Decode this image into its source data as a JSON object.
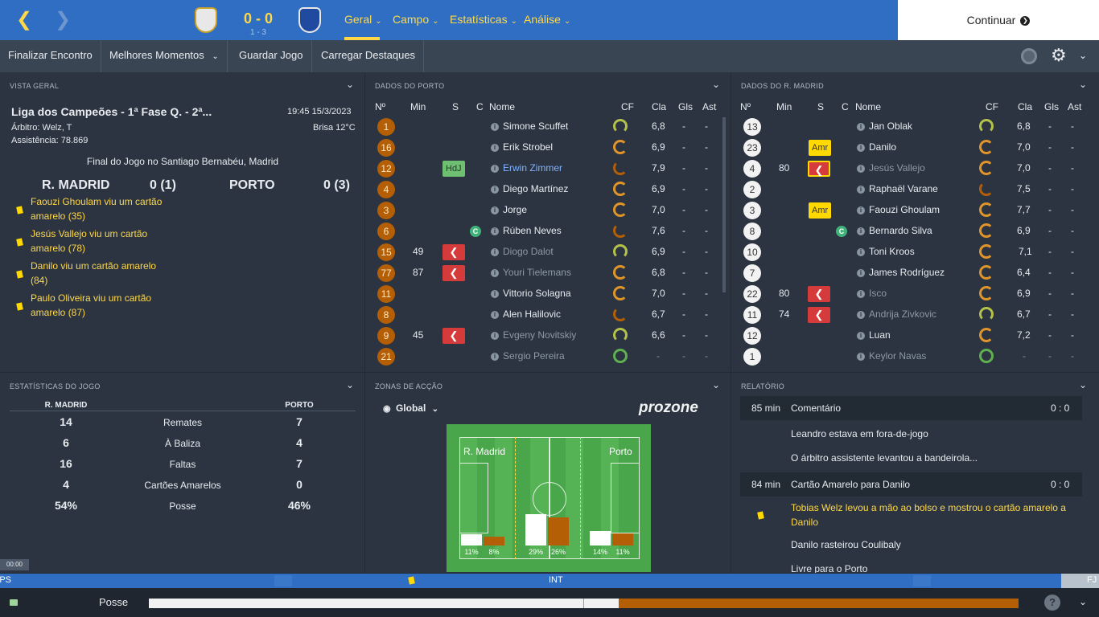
{
  "header": {
    "score": "0 - 0",
    "aggregate": "1 - 3",
    "tabs": [
      {
        "label": "Geral"
      },
      {
        "label": "Campo"
      },
      {
        "label": "Estatísticas"
      },
      {
        "label": "Análise"
      }
    ],
    "continue_label": "Continuar",
    "colors": {
      "accent": "#2f6ec2",
      "highlight": "#ffd84a"
    }
  },
  "toolbar": {
    "items": [
      "Finalizar Encontro",
      "Melhores Momentos",
      "Guardar Jogo",
      "Carregar Destaques"
    ]
  },
  "overview": {
    "title": "VISTA GERAL",
    "competition": "Liga dos Campeões - 1ª Fase Q. - 2ª...",
    "datetime": "19:45 15/3/2023",
    "referee": "Árbitro: Welz, T",
    "weather": "Brisa 12°C",
    "attendance": "Assistência: 78.869",
    "status": "Final do Jogo no Santiago Bernabéu, Madrid",
    "home_team": "R. MADRID",
    "home_score": "0 (1)",
    "away_team": "PORTO",
    "away_score": "0 (3)",
    "events": [
      "Faouzi Ghoulam viu um cartão amarelo (35)",
      "Jesús Vallejo viu um cartão amarelo (78)",
      "Danilo viu um cartão amarelo (84)",
      "Paulo Oliveira viu um cartão amarelo (87)"
    ]
  },
  "porto": {
    "title": "DADOS DO PORTO",
    "columns": [
      "Nº",
      "Min",
      "S",
      "C",
      "Nome",
      "CF",
      "Cla",
      "Gls",
      "Ast"
    ],
    "players": [
      {
        "no": "1",
        "min": "",
        "name": "Simone Scuffet",
        "cla": "6,8",
        "gls": "-",
        "ast": "-"
      },
      {
        "no": "16",
        "min": "",
        "name": "Erik Strobel",
        "cla": "6,9",
        "gls": "-",
        "ast": "-"
      },
      {
        "no": "12",
        "min": "",
        "tag": "HdJ",
        "name": "Erwin Zimmer",
        "cla": "7,9",
        "gls": "-",
        "ast": "-"
      },
      {
        "no": "4",
        "min": "",
        "name": "Diego Martínez",
        "cla": "6,9",
        "gls": "-",
        "ast": "-"
      },
      {
        "no": "3",
        "min": "",
        "name": "Jorge",
        "cla": "7,0",
        "gls": "-",
        "ast": "-"
      },
      {
        "no": "6",
        "min": "",
        "captain": "C",
        "name": "Rúben Neves",
        "cla": "7,6",
        "gls": "-",
        "ast": "-"
      },
      {
        "no": "15",
        "min": "49",
        "name": "Diogo Dalot",
        "cla": "6,9",
        "gls": "-",
        "ast": "-"
      },
      {
        "no": "77",
        "min": "87",
        "name": "Youri Tielemans",
        "cla": "6,8",
        "gls": "-",
        "ast": "-"
      },
      {
        "no": "11",
        "min": "",
        "name": "Vittorio Solagna",
        "cla": "7,0",
        "gls": "-",
        "ast": "-"
      },
      {
        "no": "8",
        "min": "",
        "name": "Alen Halilovic",
        "cla": "6,7",
        "gls": "-",
        "ast": "-"
      },
      {
        "no": "9",
        "min": "45",
        "name": "Evgeny Novitskiy",
        "cla": "6,6",
        "gls": "-",
        "ast": "-"
      },
      {
        "no": "21",
        "min": "",
        "name": "Sergio Pereira",
        "cla": "-",
        "gls": "-",
        "ast": "-"
      }
    ]
  },
  "madrid": {
    "title": "DADOS DO R. MADRID",
    "columns": [
      "Nº",
      "Min",
      "S",
      "C",
      "Nome",
      "CF",
      "Cla",
      "Gls",
      "Ast"
    ],
    "players": [
      {
        "no": "13",
        "min": "",
        "name": "Jan Oblak",
        "cla": "6,8",
        "gls": "-",
        "ast": "-"
      },
      {
        "no": "23",
        "min": "",
        "tag": "Amr",
        "name": "Danilo",
        "cla": "7,0",
        "gls": "-",
        "ast": "-"
      },
      {
        "no": "4",
        "min": "80",
        "name": "Jesús Vallejo",
        "cla": "7,0",
        "gls": "-",
        "ast": "-"
      },
      {
        "no": "2",
        "min": "",
        "name": "Raphaël Varane",
        "cla": "7,5",
        "gls": "-",
        "ast": "-"
      },
      {
        "no": "3",
        "min": "",
        "tag": "Amr",
        "name": "Faouzi Ghoulam",
        "cla": "7,7",
        "gls": "-",
        "ast": "-"
      },
      {
        "no": "8",
        "min": "",
        "captain": "C",
        "name": "Bernardo Silva",
        "cla": "6,9",
        "gls": "-",
        "ast": "-"
      },
      {
        "no": "10",
        "min": "",
        "name": "Toni Kroos",
        "cla": "7,1",
        "gls": "-",
        "ast": "-"
      },
      {
        "no": "7",
        "min": "",
        "name": "James Rodríguez",
        "cla": "6,4",
        "gls": "-",
        "ast": "-"
      },
      {
        "no": "22",
        "min": "80",
        "name": "Isco",
        "cla": "6,9",
        "gls": "-",
        "ast": "-"
      },
      {
        "no": "11",
        "min": "74",
        "name": "Andrija Zivkovic",
        "cla": "6,7",
        "gls": "-",
        "ast": "-"
      },
      {
        "no": "12",
        "min": "",
        "name": "Luan",
        "cla": "7,2",
        "gls": "-",
        "ast": "-"
      },
      {
        "no": "1",
        "min": "",
        "name": "Keylor Navas",
        "cla": "-",
        "gls": "-",
        "ast": "-"
      }
    ]
  },
  "stats": {
    "title": "ESTATÍSTICAS DO JOGO",
    "home": "R. MADRID",
    "away": "PORTO",
    "rows": [
      {
        "home": "14",
        "label": "Remates",
        "away": "7"
      },
      {
        "home": "6",
        "label": "À Baliza",
        "away": "4"
      },
      {
        "home": "16",
        "label": "Faltas",
        "away": "7"
      },
      {
        "home": "4",
        "label": "Cartões Amarelos",
        "away": "0"
      },
      {
        "home": "54%",
        "label": "Posse",
        "away": "46%"
      }
    ]
  },
  "zones": {
    "title": "ZONAS DE ACÇÃO",
    "view_label": "Global",
    "brand": "prozone",
    "home_label": "R. Madrid",
    "away_label": "Porto",
    "labels": [
      "11%",
      "8%",
      "29%",
      "26%",
      "14%",
      "11%"
    ]
  },
  "report": {
    "title": "RELATÓRIO",
    "blocks": [
      {
        "min": "85 min",
        "head": "Comentário",
        "score": "0 : 0"
      },
      {
        "min": "84 min",
        "head": "Cartão Amarelo para Danilo",
        "score": "0 : 0"
      }
    ],
    "lines": [
      "Leandro estava em fora-de-jogo",
      "O árbitro assistente levantou a bandeirola...",
      "Tobias Welz levou a mão ao bolso e mostrou o cartão amarelo a Danilo",
      "Danilo rasteirou Coulibaly",
      "Livre para o Porto"
    ]
  },
  "timeline": {
    "clock": "00:00",
    "left": "PS",
    "mid": "INT",
    "right": "FJ"
  },
  "bottom": {
    "label": "Posse",
    "home_possession": 0.54,
    "away_possession": 0.46
  }
}
